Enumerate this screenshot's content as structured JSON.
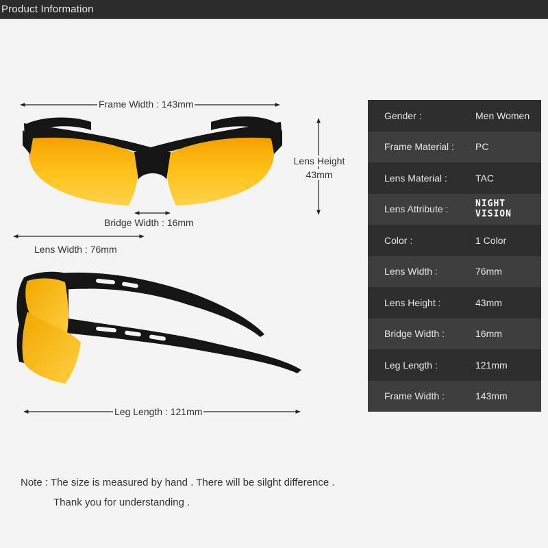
{
  "header": {
    "title": "Product Information"
  },
  "dimensions": {
    "frame_width": "Frame Width : 143mm",
    "lens_height_line1": "Lens Height",
    "lens_height_line2": "43mm",
    "bridge_width": "Bridge Width : 16mm",
    "lens_width": "Lens Width : 76mm",
    "leg_length": "Leg Length : 121mm"
  },
  "specs": [
    {
      "label": "Gender :",
      "value": "Men Women"
    },
    {
      "label": "Frame Material :",
      "value": "PC"
    },
    {
      "label": "Lens Material :",
      "value": "TAC"
    },
    {
      "label": "Lens Attribute :",
      "value": "NIGHT VISION"
    },
    {
      "label": "Color :",
      "value": "1 Color"
    },
    {
      "label": "Lens Width :",
      "value": "76mm"
    },
    {
      "label": "Lens Height :",
      "value": "43mm"
    },
    {
      "label": "Bridge Width :",
      "value": "16mm"
    },
    {
      "label": "Leg Length :",
      "value": "121mm"
    },
    {
      "label": "Frame Width :",
      "value": "143mm"
    }
  ],
  "note": {
    "line1": "Note : The size is measured by hand . There will be silght difference .",
    "line2": "Thank you for understanding ."
  },
  "colors": {
    "lens": "#f7b800",
    "frame": "#151515",
    "table_dark": "#2e2e2e",
    "table_light": "#3e3e3e"
  }
}
